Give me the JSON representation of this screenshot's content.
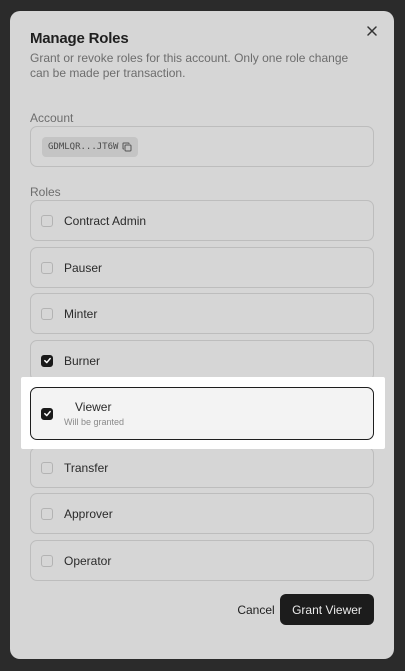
{
  "dialog": {
    "title": "Manage Roles",
    "description": "Grant or revoke roles for this account. Only one role change can be made per transaction."
  },
  "account": {
    "label": "Account",
    "address": "GDMLQR...JT6W"
  },
  "roles": {
    "label": "Roles",
    "items": [
      {
        "label": "Contract Admin",
        "checked": false
      },
      {
        "label": "Pauser",
        "checked": false
      },
      {
        "label": "Minter",
        "checked": false
      },
      {
        "label": "Burner",
        "checked": true
      },
      {
        "label": "Viewer",
        "checked": true,
        "sublabel": "Will be granted"
      },
      {
        "label": "Transfer",
        "checked": false
      },
      {
        "label": "Approver",
        "checked": false
      },
      {
        "label": "Operator",
        "checked": false
      }
    ]
  },
  "footer": {
    "cancel_label": "Cancel",
    "grant_label": "Grant Viewer"
  },
  "colors": {
    "overlay": "#2b2b2b",
    "dialog_bg": "#d6d6d6",
    "primary_button": "#1c1c1c",
    "highlight": "#ffffff"
  }
}
